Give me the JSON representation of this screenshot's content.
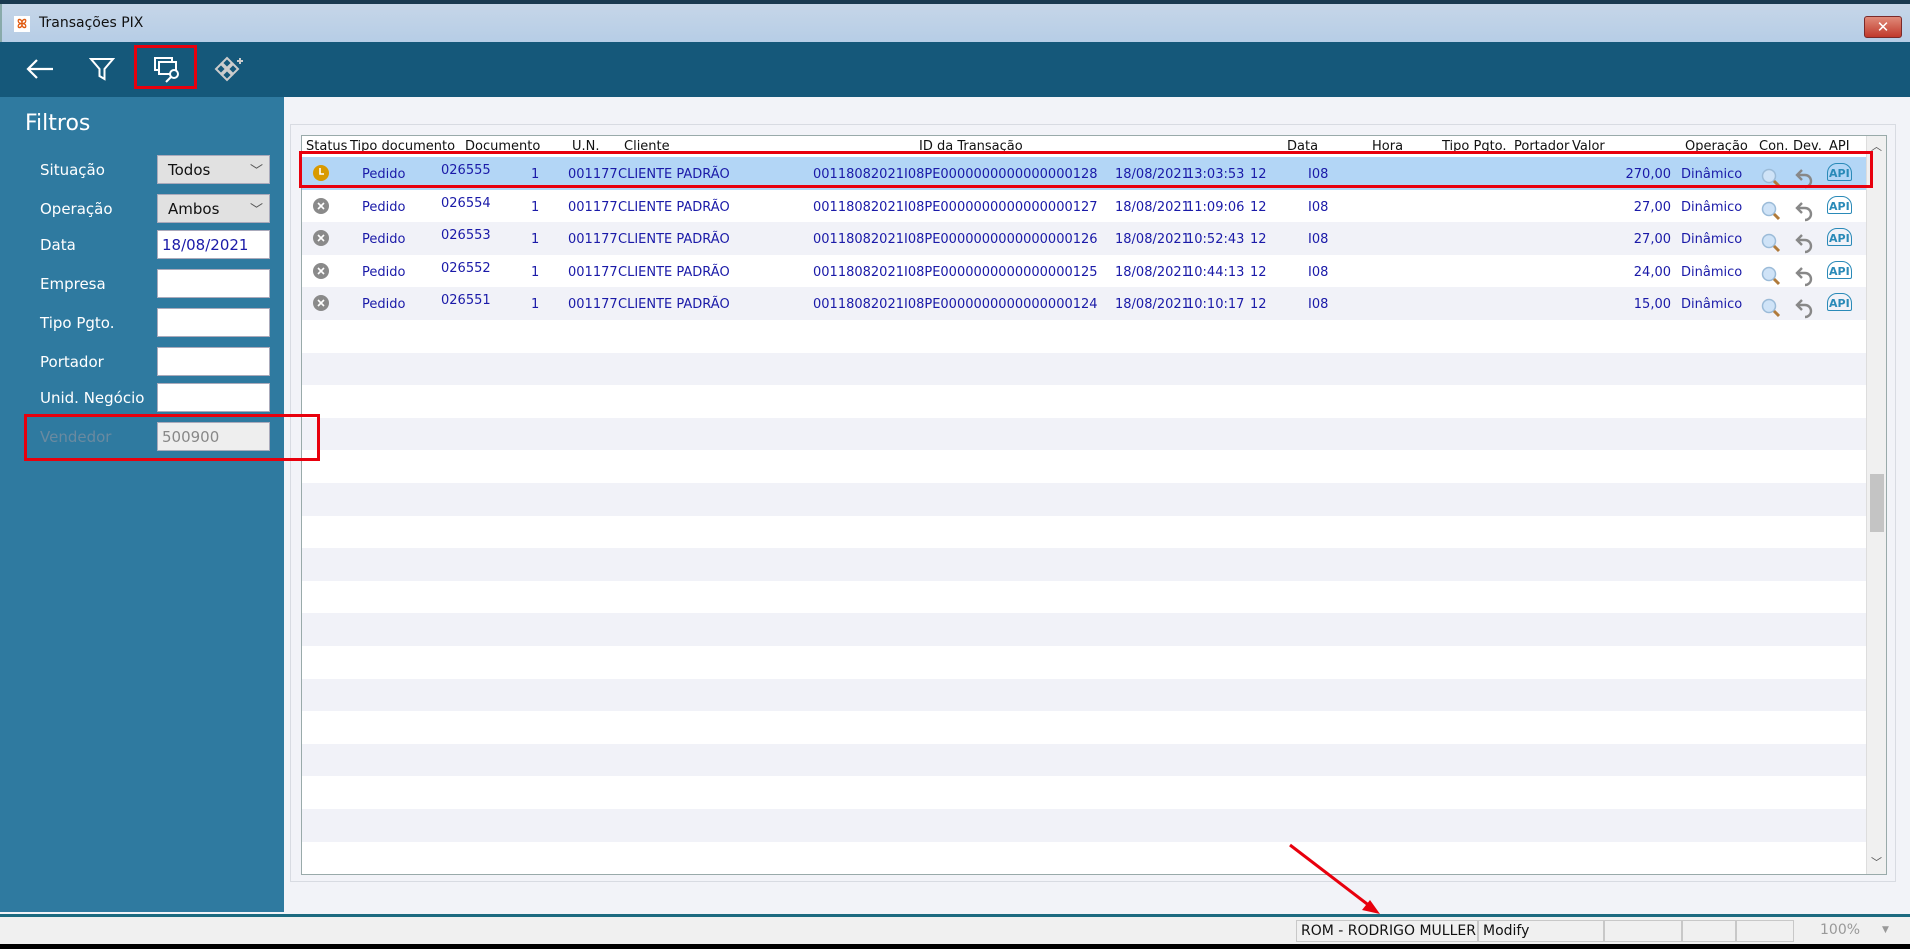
{
  "window": {
    "title": "Transações PIX",
    "close_label": "✕"
  },
  "toolbar": {
    "buttons": [
      "back-icon",
      "filter-icon",
      "search-windows-icon",
      "add-modules-icon"
    ]
  },
  "filters": {
    "heading": "Filtros",
    "situacao": {
      "label": "Situação",
      "value": "Todos"
    },
    "operacao": {
      "label": "Operação",
      "value": "Ambos"
    },
    "data": {
      "label": "Data",
      "value": "18/08/2021"
    },
    "empresa": {
      "label": "Empresa",
      "value": ""
    },
    "tipo_pgto": {
      "label": "Tipo Pgto.",
      "value": ""
    },
    "portador": {
      "label": "Portador",
      "value": ""
    },
    "unid_negocio": {
      "label": "Unid. Negócio",
      "value": ""
    },
    "vendedor": {
      "label": "Vendedor",
      "value": "500900"
    }
  },
  "grid": {
    "columns": [
      "Status",
      "Tipo documento",
      "Documento",
      "U.N.",
      "Cliente",
      "ID da Transação",
      "Data",
      "Hora",
      "Tipo Pgto.",
      "Portador",
      "Valor",
      "Operação",
      "Con.",
      "Dev.",
      "API"
    ],
    "rows": [
      {
        "status": "pending",
        "tipo": "Pedido",
        "doc": "026555",
        "un": "1",
        "cli_cod": "001177",
        "cli_nome": "CLIENTE PADRÃO",
        "id": "00118082021I08PE0000000000000000128",
        "data": "18/08/2021",
        "hora": "13:03:53",
        "tipo_pgto": "12",
        "portador": "I08",
        "valor": "270,00",
        "operacao": "Dinâmico"
      },
      {
        "status": "cancelled",
        "tipo": "Pedido",
        "doc": "026554",
        "un": "1",
        "cli_cod": "001177",
        "cli_nome": "CLIENTE PADRÃO",
        "id": "00118082021I08PE0000000000000000127",
        "data": "18/08/2021",
        "hora": "11:09:06",
        "tipo_pgto": "12",
        "portador": "I08",
        "valor": "27,00",
        "operacao": "Dinâmico"
      },
      {
        "status": "cancelled",
        "tipo": "Pedido",
        "doc": "026553",
        "un": "1",
        "cli_cod": "001177",
        "cli_nome": "CLIENTE PADRÃO",
        "id": "00118082021I08PE0000000000000000126",
        "data": "18/08/2021",
        "hora": "10:52:43",
        "tipo_pgto": "12",
        "portador": "I08",
        "valor": "27,00",
        "operacao": "Dinâmico"
      },
      {
        "status": "cancelled",
        "tipo": "Pedido",
        "doc": "026552",
        "un": "1",
        "cli_cod": "001177",
        "cli_nome": "CLIENTE PADRÃO",
        "id": "00118082021I08PE0000000000000000125",
        "data": "18/08/2021",
        "hora": "10:44:13",
        "tipo_pgto": "12",
        "portador": "I08",
        "valor": "24,00",
        "operacao": "Dinâmico"
      },
      {
        "status": "cancelled",
        "tipo": "Pedido",
        "doc": "026551",
        "un": "1",
        "cli_cod": "001177",
        "cli_nome": "CLIENTE PADRÃO",
        "id": "00118082021I08PE0000000000000000124",
        "data": "18/08/2021",
        "hora": "10:10:17",
        "tipo_pgto": "12",
        "portador": "I08",
        "valor": "15,00",
        "operacao": "Dinâmico"
      }
    ],
    "api_label": "API"
  },
  "statusbar": {
    "user": "ROM - RODRIGO MULLER",
    "mode": "Modify",
    "zoom": "100%"
  },
  "colors": {
    "toolbar": "#15587a",
    "sidebar": "#2f7aa0",
    "selected_row": "#b3d6f6",
    "annotation": "#e8000d",
    "pending": "#d99a00",
    "cancelled": "#8a8a8a"
  }
}
